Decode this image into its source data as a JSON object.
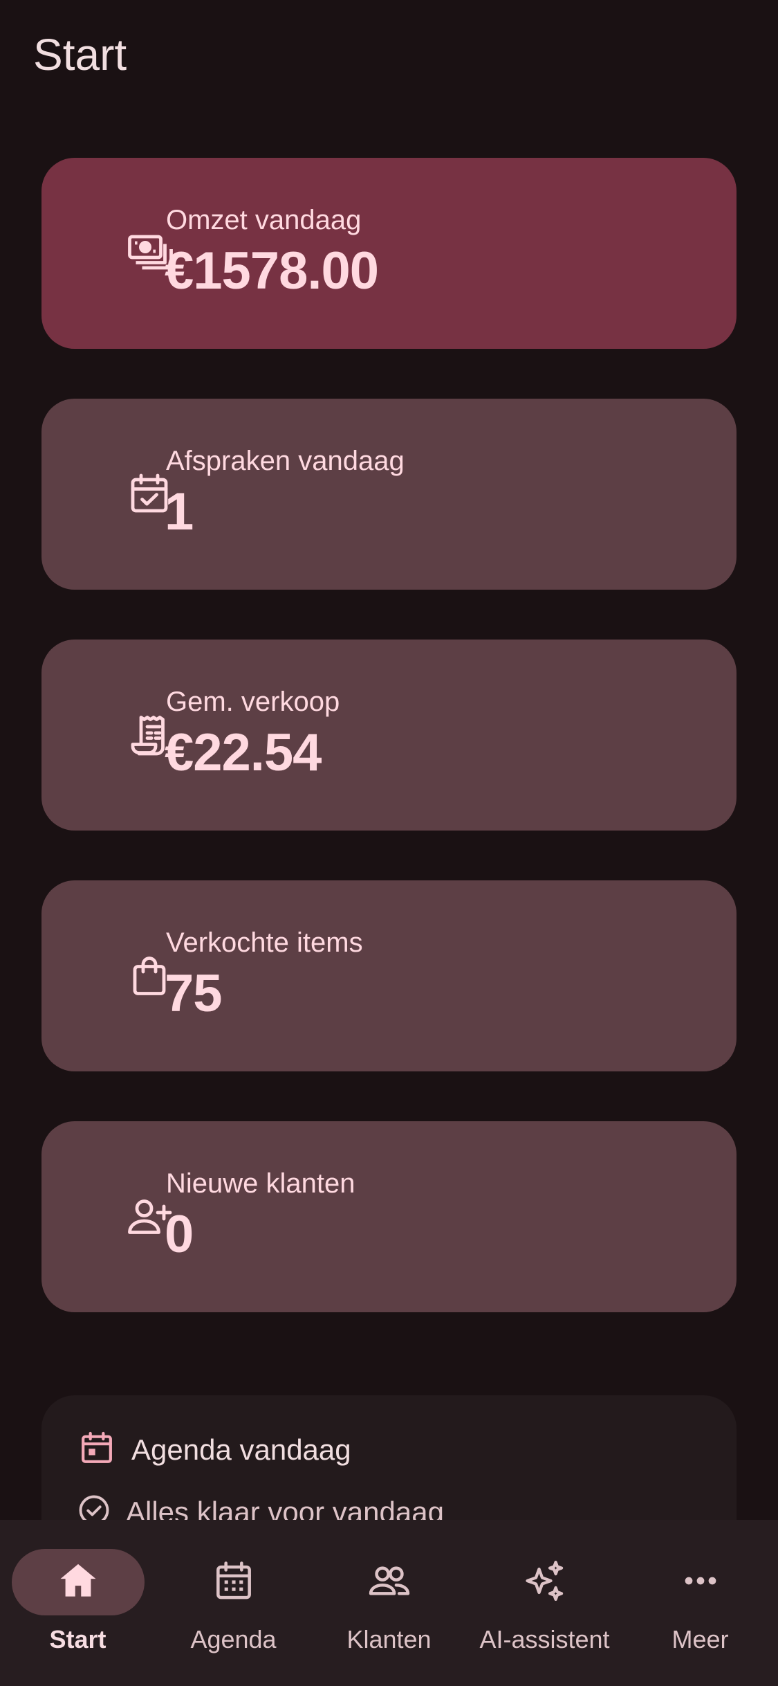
{
  "page": {
    "title": "Start"
  },
  "cards": [
    {
      "icon": "money-icon",
      "label": "Omzet vandaag",
      "value": "€1578.00"
    },
    {
      "icon": "calendar-check-icon",
      "label": "Afspraken vandaag",
      "value": "1"
    },
    {
      "icon": "receipt-icon",
      "label": "Gem. verkoop",
      "value": "€22.54"
    },
    {
      "icon": "shopping-bag-icon",
      "label": "Verkochte items",
      "value": "75"
    },
    {
      "icon": "person-add-icon",
      "label": "Nieuwe klanten",
      "value": "0"
    }
  ],
  "agenda": {
    "icon": "calendar-icon",
    "title": "Agenda vandaag",
    "empty_icon": "check-circle-icon",
    "empty_text": "Alles klaar voor vandaag"
  },
  "nav": {
    "items": [
      {
        "icon": "home-icon",
        "label": "Start",
        "active": true
      },
      {
        "icon": "calendar-grid-icon",
        "label": "Agenda",
        "active": false
      },
      {
        "icon": "people-icon",
        "label": "Klanten",
        "active": false
      },
      {
        "icon": "sparkle-icon",
        "label": "AI-assistent",
        "active": false
      },
      {
        "icon": "more-horizontal-icon",
        "label": "Meer",
        "active": false
      }
    ]
  },
  "colors": {
    "background": "#1a1113",
    "primary_card": "#773243",
    "card": "#5d3f45",
    "text_accent": "#ffd9e0"
  }
}
